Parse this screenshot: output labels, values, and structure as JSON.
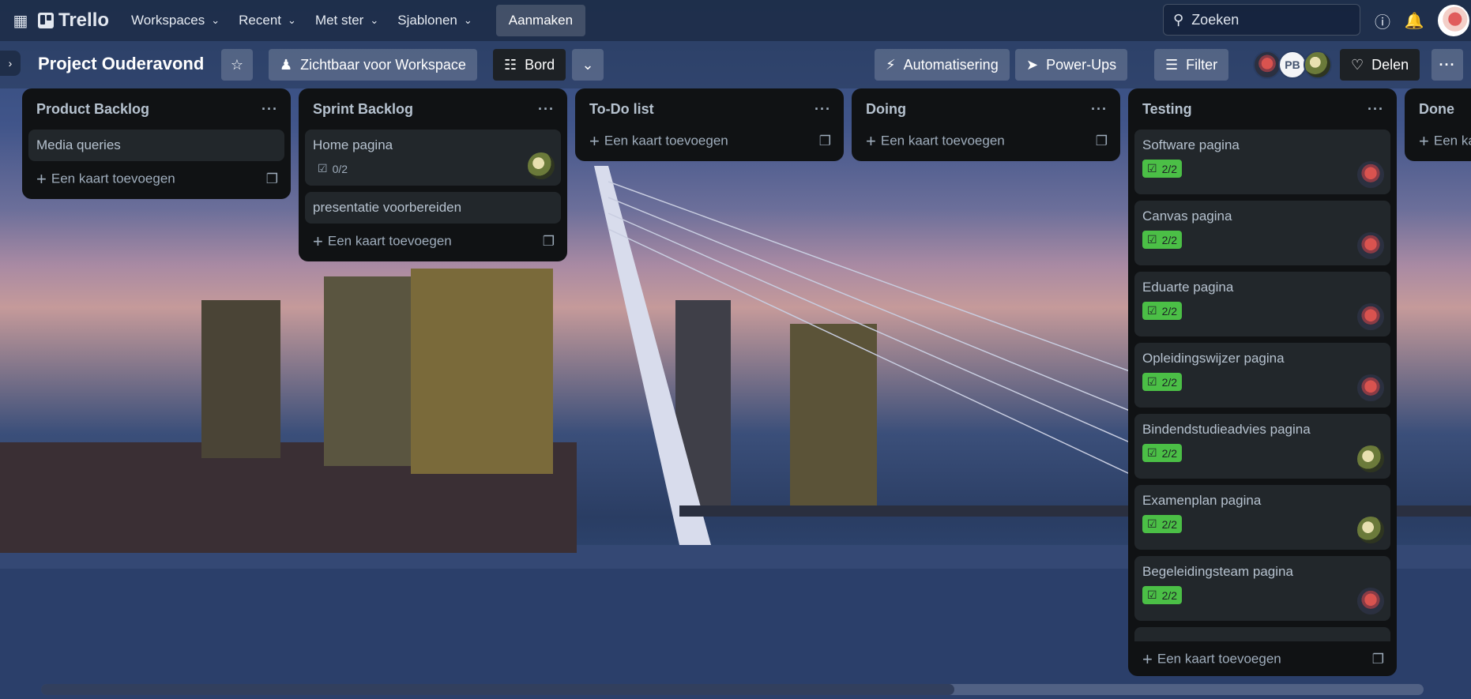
{
  "topbar": {
    "app_name": "Trello",
    "nav": [
      "Workspaces",
      "Recent",
      "Met ster",
      "Sjablonen"
    ],
    "create_label": "Aanmaken",
    "search_placeholder": "Zoeken"
  },
  "board": {
    "title": "Project Ouderavond",
    "visibility": "Zichtbaar voor Workspace",
    "view": "Bord",
    "automation": "Automatisering",
    "powerups": "Power-Ups",
    "filter": "Filter",
    "share": "Delen",
    "member_initials": "PB"
  },
  "add_card_label": "Een kaart toevoegen",
  "lists": [
    {
      "title": "Product Backlog",
      "cards": [
        {
          "title": "Media queries"
        }
      ]
    },
    {
      "title": "Sprint Backlog",
      "cards": [
        {
          "title": "Home pagina",
          "checklist": "0/2"
        },
        {
          "title": "presentatie voorbereiden"
        }
      ]
    },
    {
      "title": "To-Do list",
      "cards": []
    },
    {
      "title": "Doing",
      "cards": []
    },
    {
      "title": "Testing",
      "cards": [
        {
          "title": "Software pagina",
          "checklist": "2/2"
        },
        {
          "title": "Canvas pagina",
          "checklist": "2/2"
        },
        {
          "title": "Eduarte pagina",
          "checklist": "2/2"
        },
        {
          "title": "Opleidingswijzer pagina",
          "checklist": "2/2"
        },
        {
          "title": "Bindendstudieadvies pagina",
          "checklist": "2/2"
        },
        {
          "title": "Examenplan pagina",
          "checklist": "2/2"
        },
        {
          "title": "Begeleidingsteam pagina",
          "checklist": "2/2"
        }
      ]
    },
    {
      "title": "Done",
      "cards": []
    }
  ],
  "colors": {
    "topbar": "#1d2c48",
    "list_bg": "#101214",
    "card_bg": "#22272b",
    "check_green": "#4bbf46"
  }
}
